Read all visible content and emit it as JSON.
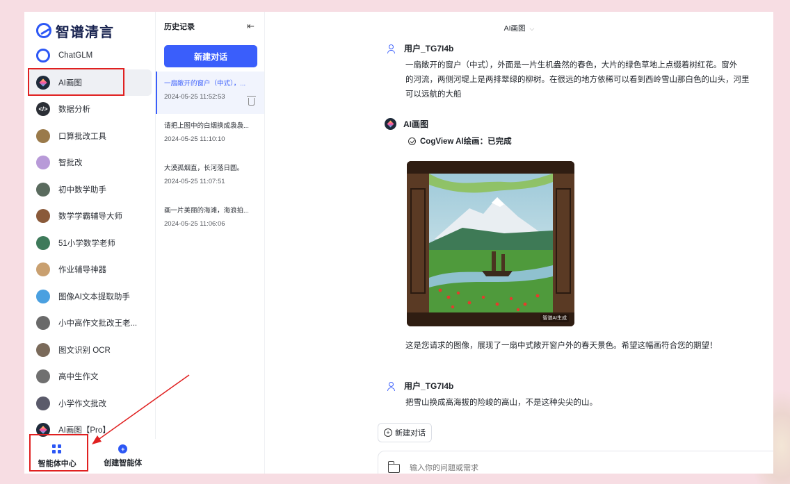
{
  "brand": {
    "name": "智谱清言"
  },
  "sidebar": {
    "items": [
      {
        "label": "ChatGLM",
        "icon": "chatglm-icon",
        "color": "#2c57f5"
      },
      {
        "label": "AI画图",
        "icon": "ai-draw-icon",
        "color": "#1e2a3a",
        "active": true
      },
      {
        "label": "数据分析",
        "icon": "code-icon",
        "color": "#2b2f36"
      },
      {
        "label": "口算批改工具",
        "icon": "avatar-icon",
        "color": "#9a7a4a"
      },
      {
        "label": "智批改",
        "icon": "avatar-icon",
        "color": "#b89ad8"
      },
      {
        "label": "初中数学助手",
        "icon": "avatar-icon",
        "color": "#5a6b5e"
      },
      {
        "label": "数学学霸辅导大师",
        "icon": "avatar-icon",
        "color": "#8a5a3a"
      },
      {
        "label": "51小学数学老师",
        "icon": "avatar-icon",
        "color": "#3e7a5a"
      },
      {
        "label": "作业辅导神器",
        "icon": "avatar-icon",
        "color": "#c9a070"
      },
      {
        "label": "图像AI文本提取助手",
        "icon": "avatar-icon",
        "color": "#4aa0e0"
      },
      {
        "label": "小中高作文批改王老...",
        "icon": "avatar-icon",
        "color": "#6a6a6a"
      },
      {
        "label": "图文识别 OCR",
        "icon": "avatar-icon",
        "color": "#7a6a5a"
      },
      {
        "label": "高中生作文",
        "icon": "avatar-icon",
        "color": "#707070"
      },
      {
        "label": "小学作文批改",
        "icon": "avatar-icon",
        "color": "#5a5a6a"
      },
      {
        "label": "AI画图【Pro】",
        "icon": "ai-draw-icon",
        "color": "#1e2a3a"
      }
    ],
    "bottom": {
      "agent_center": "智能体中心",
      "create_agent": "创建智能体"
    }
  },
  "history": {
    "title": "历史记录",
    "new_chat": "新建对话",
    "items": [
      {
        "text": "一扇敞开的窗户（中式），...",
        "time": "2024-05-25 11:52:53",
        "active": true
      },
      {
        "text": "请把上图中的白烟换成袅袅...",
        "time": "2024-05-25 11:10:10"
      },
      {
        "text": "大漠孤烟直，长河落日圆。",
        "time": "2024-05-25 11:07:51"
      },
      {
        "text": "画一片美丽的海滩，海浪拍...",
        "time": "2024-05-25 11:06:06"
      }
    ]
  },
  "chat": {
    "title": "AI画图",
    "messages": [
      {
        "role": "user",
        "name": "用户_TG7I4b",
        "lines": [
          "一扇敞开的窗户（中式），外面是一片生机盎然的春色，大片的绿色草地上点缀着树红花。窗外",
          "的河流，两侧河堤上是两排翠绿的柳树。在很远的地方依稀可以看到西岭雪山那白色的山头，河里",
          "可以远航的大船"
        ]
      },
      {
        "role": "bot",
        "name": "AI画图",
        "status": "CogView AI绘画：已完成",
        "image_watermark": "智谱AI生成",
        "caption": "这是您请求的图像，展现了一扇中式敞开窗户外的春天景色。希望这幅画符合您的期望！"
      },
      {
        "role": "user",
        "name": "用户_TG7I4b",
        "lines": [
          "把雪山换成高海拔的险峻的高山，不是这种尖尖的山。"
        ]
      }
    ],
    "new_chat_chip": "新建对话",
    "input_placeholder": "输入你的问题或需求"
  },
  "colors": {
    "accent": "#3a5efb",
    "annotation": "#e02020",
    "page_bg": "#f7dde3"
  }
}
